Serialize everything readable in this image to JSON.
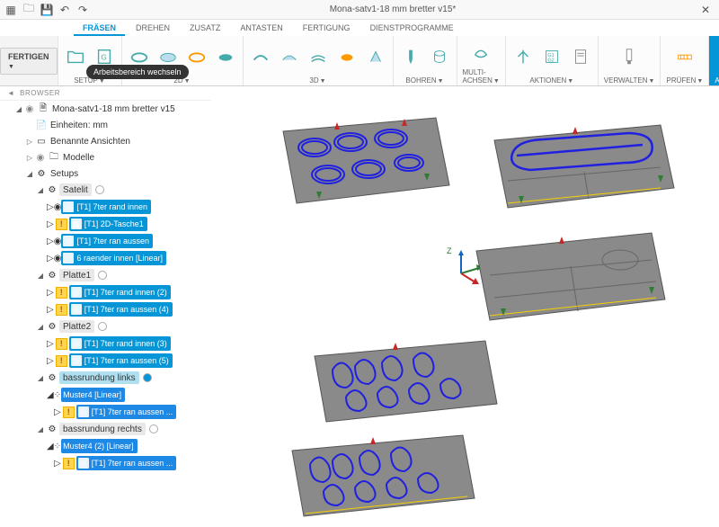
{
  "title": "Mona-satv1-18 mm bretter v15*",
  "workspace_button": "FERTIGEN",
  "tooltip": "Arbeitsbereich wechseln",
  "tabs": [
    "FRÄSEN",
    "DREHEN",
    "ZUSATZ",
    "ANTASTEN",
    "FERTIGUNG",
    "DIENSTPROGRAMME"
  ],
  "active_tab": 0,
  "ribbon_groups": [
    {
      "label": "SETUP"
    },
    {
      "label": "2D"
    },
    {
      "label": "3D"
    },
    {
      "label": "BOHREN"
    },
    {
      "label": "MULTI-ACHSEN"
    },
    {
      "label": "AKTIONEN"
    },
    {
      "label": "VERWALTEN"
    },
    {
      "label": "PRÜFEN"
    },
    {
      "label": "AUSWÄHLEN"
    }
  ],
  "browser_title": "BROWSER",
  "tree": {
    "root": "Mona-satv1-18 mm bretter v15",
    "units": "Einheiten: mm",
    "named_views": "Benannte Ansichten",
    "models": "Modelle",
    "setups": "Setups",
    "setup_list": [
      {
        "name": "Satelit",
        "ops": [
          {
            "label": "[T1] 7ter rand innen",
            "warn": false
          },
          {
            "label": "[T1] 2D-Tasche1",
            "warn": true
          },
          {
            "label": "[T1] 7ter ran aussen",
            "warn": false
          },
          {
            "label": "6 raender innen [Linear]",
            "warn": false,
            "pattern": true
          }
        ]
      },
      {
        "name": "Platte1",
        "ops": [
          {
            "label": "[T1] 7ter rand innen (2)",
            "warn": true
          },
          {
            "label": "[T1] 7ter ran aussen (4)",
            "warn": true
          }
        ]
      },
      {
        "name": "Platte2",
        "ops": [
          {
            "label": "[T1] 7ter rand innen (3)",
            "warn": true
          },
          {
            "label": "[T1] 7ter ran aussen (5)",
            "warn": true
          }
        ]
      },
      {
        "name": "bassrundung links",
        "selected": true,
        "ops": [
          {
            "label": "Muster4 [Linear]",
            "pattern": true,
            "radio": true,
            "children": [
              {
                "label": "[T1] 7ter ran aussen ...",
                "warn": true
              }
            ]
          }
        ]
      },
      {
        "name": "bassrundung rechts",
        "ops": [
          {
            "label": "Muster4 (2) [Linear]",
            "pattern": true,
            "radio": true,
            "children": [
              {
                "label": "[T1] 7ter ran aussen ...",
                "warn": true
              }
            ]
          }
        ]
      }
    ]
  },
  "triad": {
    "z": "Z",
    "x": "",
    "y": ""
  }
}
